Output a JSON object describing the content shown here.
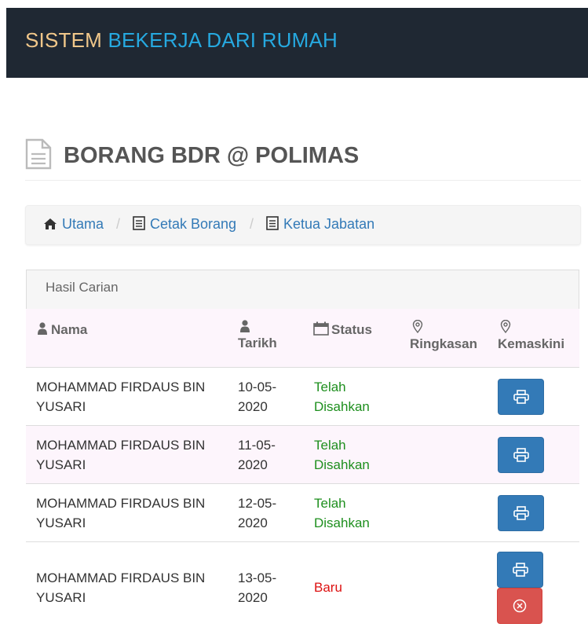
{
  "navbar": {
    "brand_part1": "SISTEM",
    "brand_part2": "BEKERJA DARI RUMAH"
  },
  "page": {
    "title": "BORANG BDR @ POLIMAS"
  },
  "breadcrumb": [
    {
      "label": "Utama",
      "icon": "home-icon"
    },
    {
      "label": "Cetak Borang",
      "icon": "list-icon"
    },
    {
      "label": "Ketua Jabatan",
      "icon": "list-icon"
    }
  ],
  "breadcrumb_separator": "/",
  "panel": {
    "heading": "Hasil Carian"
  },
  "table": {
    "columns": {
      "nama": "Nama",
      "tarikh": "Tarikh",
      "status": "Status",
      "ringkasan": "Ringkasan",
      "kemaskini": "Kemaskini"
    },
    "rows": [
      {
        "nama_line1": "MOHAMMAD FIRDAUS BIN",
        "nama_line2": "YUSARI",
        "tarikh_line1": "10-05-",
        "tarikh_line2": "2020",
        "status_line1": "Telah",
        "status_line2": "Disahkan"
      },
      {
        "nama_line1": "MOHAMMAD FIRDAUS BIN",
        "nama_line2": "YUSARI",
        "tarikh_line1": "11-05-",
        "tarikh_line2": "2020",
        "status_line1": "Telah",
        "status_line2": "Disahkan"
      },
      {
        "nama_line1": "MOHAMMAD FIRDAUS BIN",
        "nama_line2": "YUSARI",
        "tarikh_line1": "12-05-",
        "tarikh_line2": "2020",
        "status_line1": "Telah",
        "status_line2": "Disahkan"
      },
      {
        "nama_line1": "MOHAMMAD FIRDAUS BIN",
        "nama_line2": "YUSARI",
        "tarikh_line1": "13-05-",
        "tarikh_line2": "2020",
        "status": "Baru"
      }
    ]
  },
  "colors": {
    "navbar_bg": "#1f2833",
    "brand_part1": "#f0c78a",
    "brand_part2": "#26a9e0",
    "link": "#337ab7",
    "status_approved": "#1e8f1e",
    "status_new": "#dd1111",
    "print_button": "#337ab7",
    "cancel_button": "#d9534f",
    "row_highlight": "#fdf5fc"
  }
}
